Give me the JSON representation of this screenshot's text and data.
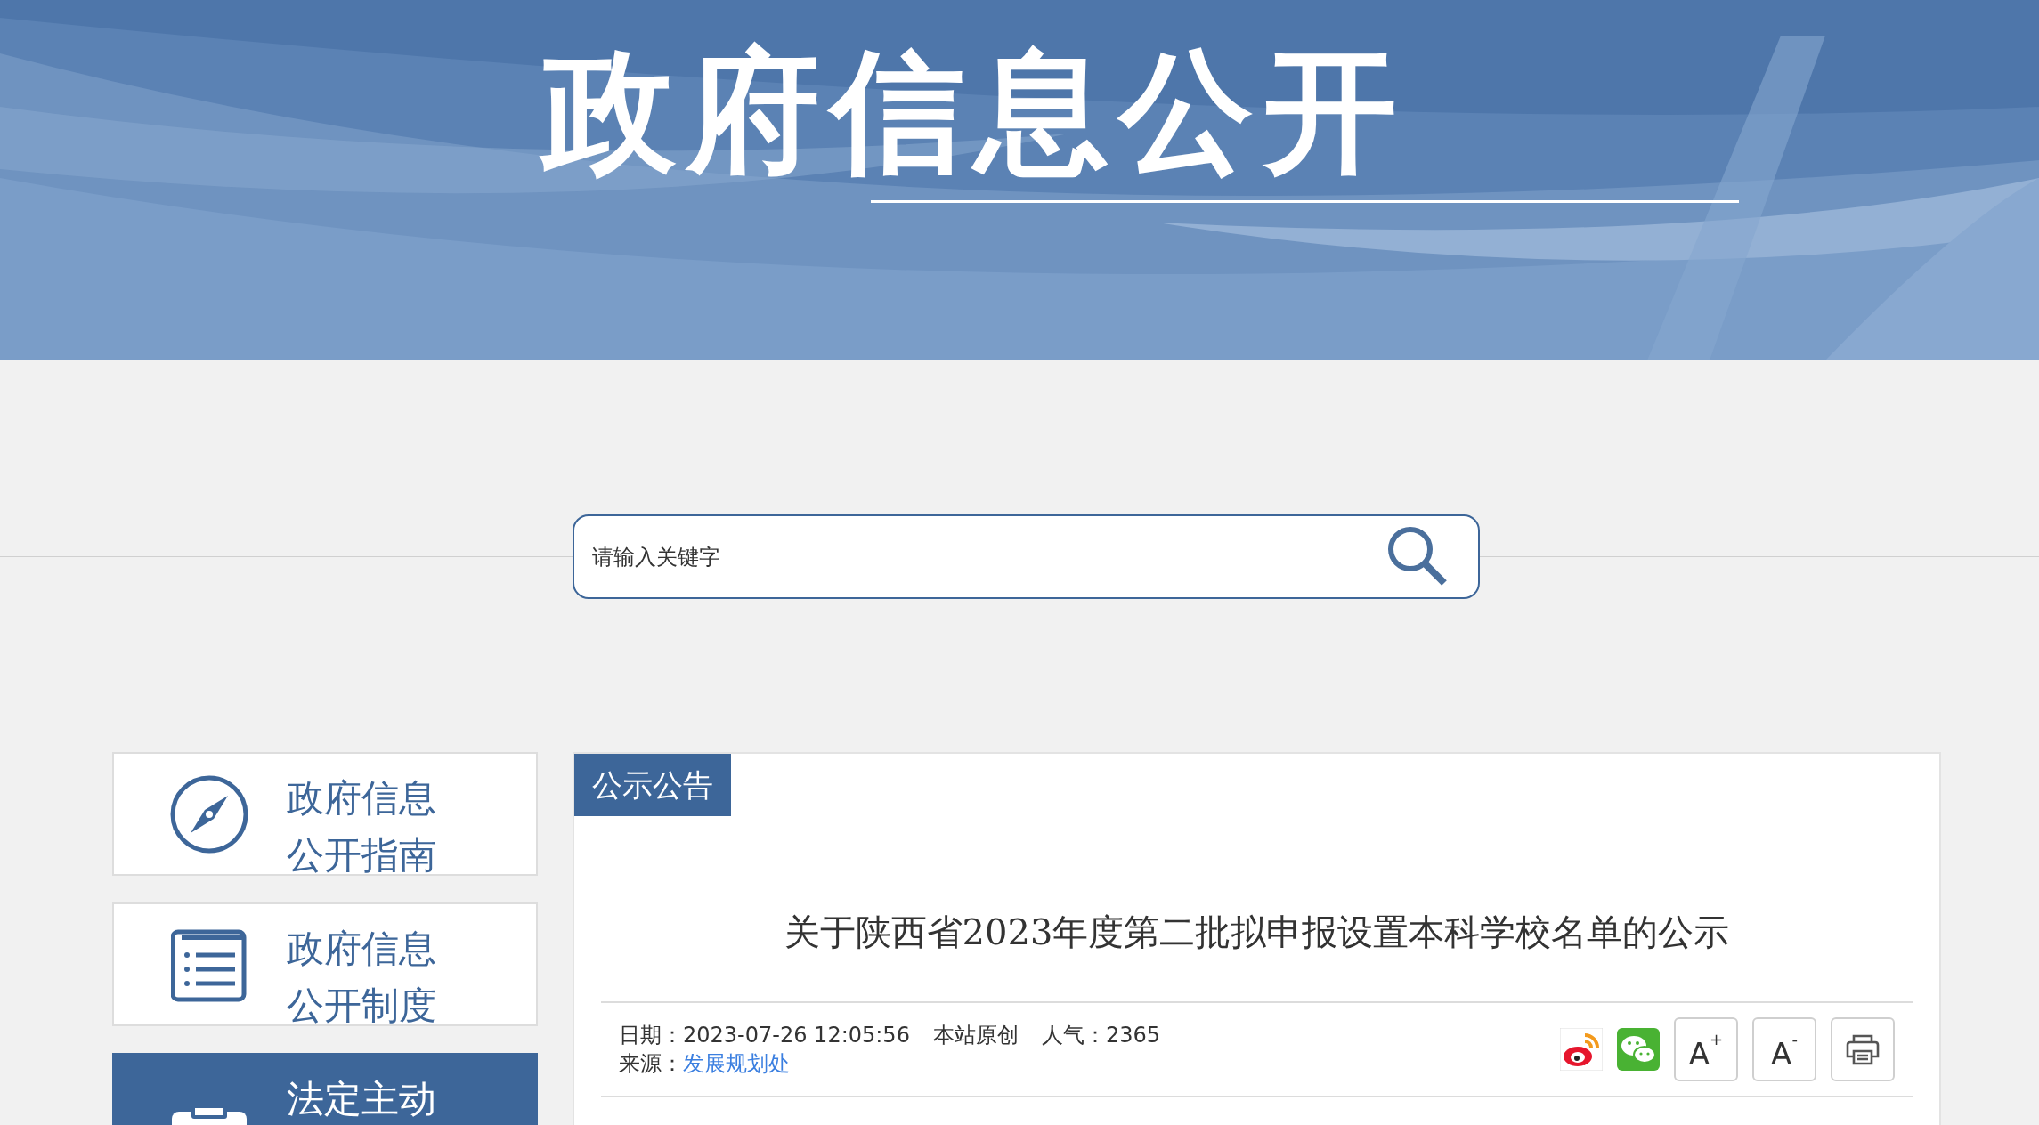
{
  "header": {
    "title": "政府信息公开"
  },
  "search": {
    "placeholder": "请输入关键字"
  },
  "sidebar": {
    "items": [
      {
        "kind": "compass",
        "label": "政府信息公开指南",
        "selected": false
      },
      {
        "kind": "list",
        "label": "政府信息公开制度",
        "selected": false
      },
      {
        "kind": "clipboard",
        "label": "法定主动",
        "selected": true
      }
    ]
  },
  "article": {
    "section_tab": "公示公告",
    "title": "关于陕西省2023年度第二批拟申报设置本科学校名单的公示",
    "date_label": "日期：",
    "date": "2023-07-26 12:05:56",
    "origin": "本站原创",
    "views_label": "人气：",
    "views": "2365",
    "source_label": "来源：",
    "source": "发展规划处",
    "tools": [
      {
        "kind": "weibo"
      },
      {
        "kind": "wechat"
      },
      {
        "kind": "font_larger",
        "label": "A",
        "sup": "+"
      },
      {
        "kind": "font_smaller",
        "label": "A",
        "sup": "-"
      },
      {
        "kind": "print"
      }
    ]
  }
}
